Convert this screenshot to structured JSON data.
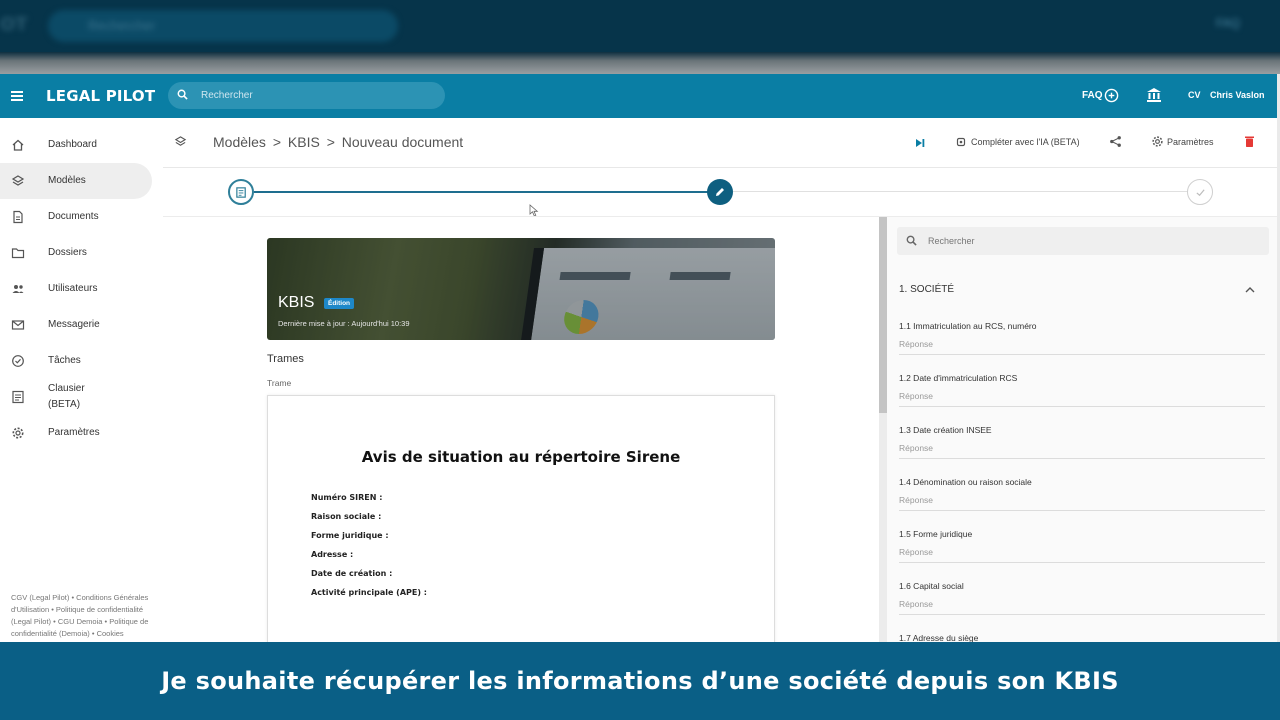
{
  "background_header": {
    "logo": "OT",
    "search_placeholder": "Rechercher",
    "faq": "FAQ"
  },
  "header": {
    "brand": "LEGAL PILOT",
    "search_placeholder": "Rechercher",
    "faq_label": "FAQ",
    "user_initials": "CV",
    "user_name": "Chris Vaslon",
    "accent": "#0a7ea4"
  },
  "sidebar": {
    "items": [
      {
        "label": "Dashboard",
        "icon": "home-icon"
      },
      {
        "label": "Modèles",
        "icon": "layers-icon"
      },
      {
        "label": "Documents",
        "icon": "document-icon"
      },
      {
        "label": "Dossiers",
        "icon": "folder-icon"
      },
      {
        "label": "Utilisateurs",
        "icon": "users-icon"
      },
      {
        "label": "Messagerie",
        "icon": "mail-icon"
      },
      {
        "label": "Tâches",
        "icon": "check-circle-icon"
      },
      {
        "label": "Clausier",
        "label2": "(BETA)",
        "icon": "list-icon"
      },
      {
        "label": "Paramètres",
        "icon": "gear-icon"
      }
    ],
    "active_index": 1,
    "footer_links": "CGV (Legal Pilot) • Conditions Générales d'Utilisation • Politique de confidentialité (Legal Pilot) • CGU Demoia • Politique de confidentialité (Demoia) • Cookies"
  },
  "toolbar": {
    "breadcrumb": [
      "Modèles",
      ">",
      "KBIS",
      ">",
      "Nouveau document"
    ],
    "ai_label": "Compléter avec l'IA (BETA)",
    "settings_label": "Paramètres"
  },
  "stepper": {
    "steps": [
      "edit-document-step",
      "edit-step",
      "done-step"
    ],
    "current_step": 2
  },
  "template_card": {
    "title": "KBIS",
    "badge": "Édition",
    "updated": "Dernière mise à jour : Aujourd'hui 10:39"
  },
  "trames": {
    "title": "Trames",
    "label": "Trame"
  },
  "document": {
    "title": "Avis de situation au répertoire Sirene",
    "fields": [
      "Numéro SIREN :",
      "Raison sociale :",
      "Forme juridique :",
      "Adresse :",
      "Date de création :",
      "Activité principale (APE) :"
    ]
  },
  "form": {
    "search_placeholder": "Rechercher",
    "section_title": "1. SOCIÉTÉ",
    "questions": [
      {
        "label": "1.1 Immatriculation au RCS, numéro",
        "placeholder": "Réponse"
      },
      {
        "label": "1.2 Date d'immatriculation RCS",
        "placeholder": "Réponse"
      },
      {
        "label": "1.3 Date création INSEE",
        "placeholder": "Réponse"
      },
      {
        "label": "1.4 Dénomination ou raison sociale",
        "placeholder": "Réponse"
      },
      {
        "label": "1.5 Forme juridique",
        "placeholder": "Réponse"
      },
      {
        "label": "1.6 Capital social",
        "placeholder": "Réponse"
      },
      {
        "label": "1.7 Adresse du siège",
        "placeholder": ""
      }
    ]
  },
  "caption": {
    "text": "Je souhaite récupérer les informations d’une société depuis son KBIS",
    "background": "#0a5f86"
  }
}
